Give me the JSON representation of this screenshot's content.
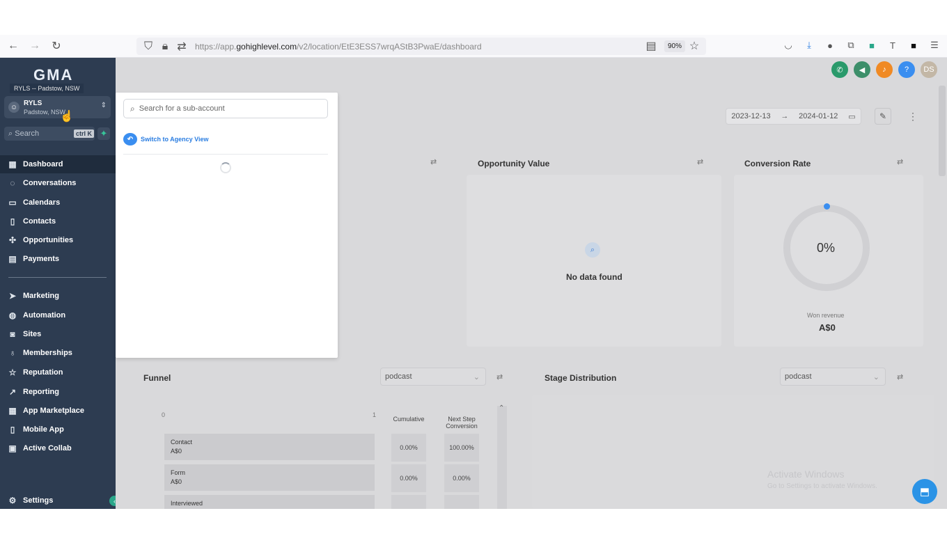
{
  "browser": {
    "url_prefix": "https://app.",
    "url_domain": "gohighlevel.com",
    "url_path": "/v2/location/EtE3ESS7wrqAStB3PwaE/dashboard",
    "zoom": "90%"
  },
  "sidebar": {
    "logo": "GMA",
    "tooltip": "RYLS -- Padstow, NSW",
    "account": {
      "name": "RYLS",
      "location": "Padstow, NSW"
    },
    "search": {
      "placeholder": "Search",
      "shortcut": "ctrl K"
    },
    "items": [
      {
        "label": "Dashboard",
        "icon": "grid-icon",
        "active": true
      },
      {
        "label": "Conversations",
        "icon": "chat-icon"
      },
      {
        "label": "Calendars",
        "icon": "calendar-icon"
      },
      {
        "label": "Contacts",
        "icon": "contacts-icon"
      },
      {
        "label": "Opportunities",
        "icon": "opportunities-icon"
      },
      {
        "label": "Payments",
        "icon": "payments-icon"
      },
      {
        "label": "Marketing",
        "icon": "send-icon"
      },
      {
        "label": "Automation",
        "icon": "automation-icon"
      },
      {
        "label": "Sites",
        "icon": "sites-icon"
      },
      {
        "label": "Memberships",
        "icon": "memberships-icon"
      },
      {
        "label": "Reputation",
        "icon": "star-icon"
      },
      {
        "label": "Reporting",
        "icon": "trend-icon"
      },
      {
        "label": "App Marketplace",
        "icon": "apps-icon"
      },
      {
        "label": "Mobile App",
        "icon": "mobile-icon"
      },
      {
        "label": "Active Collab",
        "icon": "collab-icon"
      }
    ],
    "settings": "Settings"
  },
  "header": {
    "avatar_initials": "DS",
    "help": "?",
    "date_start": "2023-12-13",
    "date_end": "2024-01-12"
  },
  "cards": {
    "opportunity_value": {
      "title": "Opportunity Value",
      "empty": "No data found"
    },
    "conversion_rate": {
      "title": "Conversion Rate",
      "percent": "0%",
      "won_label": "Won revenue",
      "won_value": "A$0"
    }
  },
  "funnel": {
    "title": "Funnel",
    "filter": "podcast",
    "axis_min": "0",
    "axis_max": "1",
    "col_cumulative": "Cumulative",
    "col_next_step": "Next Step Conversion",
    "stages": [
      {
        "name": "Contact",
        "value": "A$0",
        "cumulative": "0.00%",
        "next": "100.00%"
      },
      {
        "name": "Form",
        "value": "A$0",
        "cumulative": "0.00%",
        "next": "0.00%"
      },
      {
        "name": "Interviewed",
        "value": "",
        "cumulative": "",
        "next": ""
      }
    ]
  },
  "stage_distribution": {
    "title": "Stage Distribution",
    "filter": "podcast"
  },
  "watermark": {
    "line1": "Activate Windows",
    "line2": "Go to Settings to activate Windows."
  },
  "switcher": {
    "search_placeholder": "Search for a sub-account",
    "agency_link": "Switch to Agency View"
  }
}
